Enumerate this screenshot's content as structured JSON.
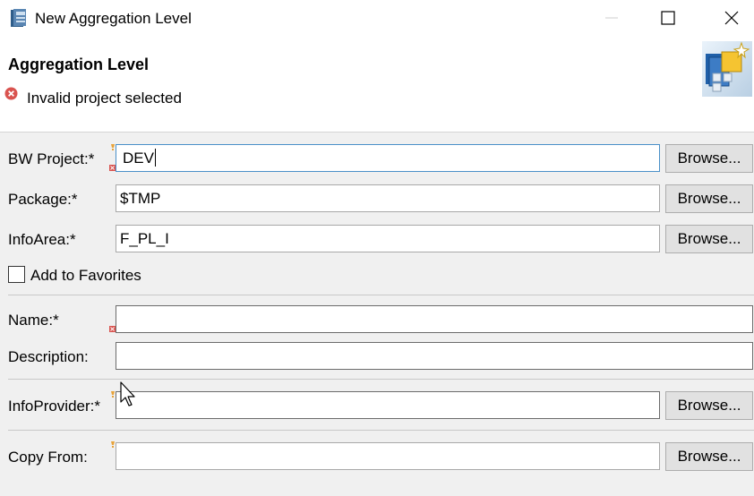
{
  "window": {
    "title": "New Aggregation Level",
    "minimize_icon": "minimize-icon",
    "maximize_icon": "maximize-icon",
    "close_icon": "close-icon"
  },
  "header": {
    "title": "Aggregation Level",
    "error_message": "Invalid project selected",
    "error_icon": "error-icon",
    "wizard_icon": "aggregation-level-wizard-icon"
  },
  "form": {
    "bw_project": {
      "label": "BW Project:*",
      "value": "DEV",
      "browse": "Browse..."
    },
    "package": {
      "label": "Package:*",
      "value": "$TMP",
      "browse": "Browse..."
    },
    "infoarea": {
      "label": "InfoArea:*",
      "value": "F_PL_I",
      "browse": "Browse..."
    },
    "favorites": {
      "label": "Add to Favorites",
      "checked": false
    },
    "name": {
      "label": "Name:*",
      "value": ""
    },
    "description": {
      "label": "Description:",
      "value": ""
    },
    "infoprovider": {
      "label": "InfoProvider:*",
      "value": "",
      "browse": "Browse..."
    },
    "copy_from": {
      "label": "Copy From:",
      "value": "",
      "browse": "Browse..."
    }
  },
  "colors": {
    "background": "#f0f0f0",
    "focus_border": "#4a90c8",
    "error_red": "#d9534f",
    "hint_orange": "#e8a33a"
  }
}
